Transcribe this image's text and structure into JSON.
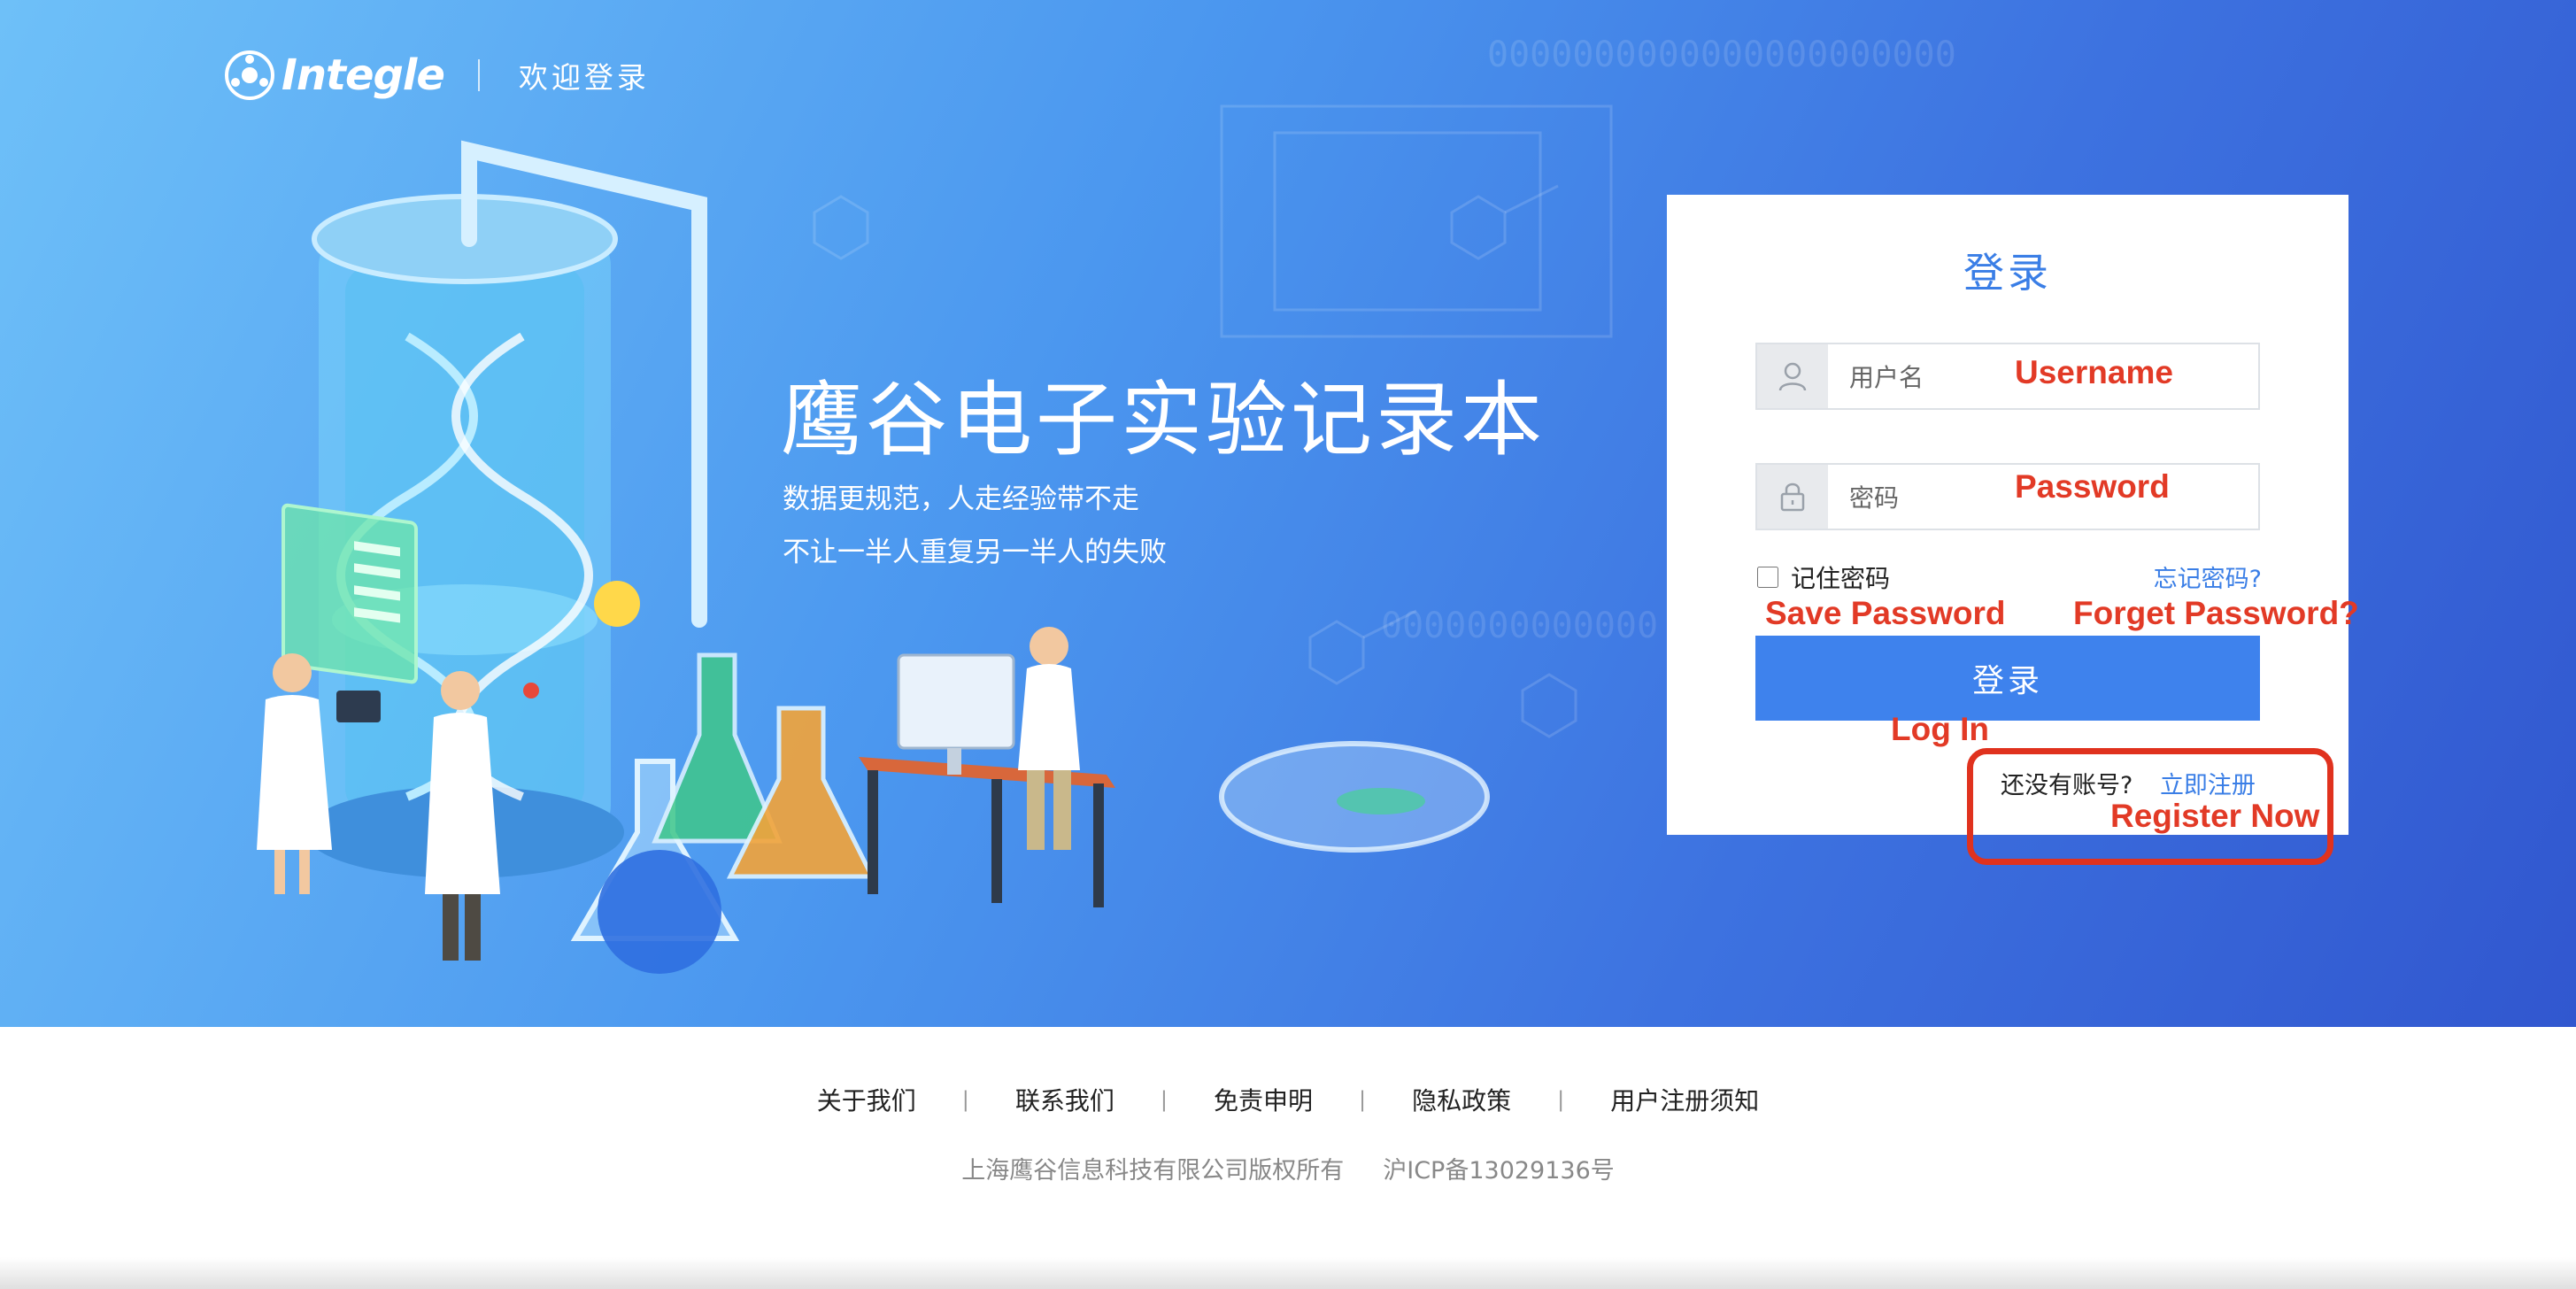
{
  "header": {
    "brand_name": "Integle",
    "welcome_text": "欢迎登录"
  },
  "hero": {
    "title": "鹰谷电子实验记录本",
    "subtitle_line1": "数据更规范，人走经验带不走",
    "subtitle_line2": "不让一半人重复另一半人的失败"
  },
  "login_form": {
    "title": "登录",
    "username_placeholder": "用户名",
    "password_placeholder": "密码",
    "remember_label": "记住密码",
    "forgot_link": "忘记密码?",
    "submit_label": "登录",
    "register_prompt": "还没有账号?",
    "register_link": "立即注册"
  },
  "annotations": {
    "username": "Username",
    "password": "Password",
    "save_password": "Save Password",
    "forget_password": "Forget Password?",
    "log_in": "Log In",
    "register_now": "Register Now"
  },
  "footer": {
    "links": [
      "关于我们",
      "联系我们",
      "免责申明",
      "隐私政策",
      "用户注册须知"
    ],
    "copyright": "上海鹰谷信息科技有限公司版权所有",
    "icp": "沪ICP备13029136号"
  },
  "colors": {
    "accent_blue": "#3e82ed",
    "annotation_red": "#e23a26"
  }
}
